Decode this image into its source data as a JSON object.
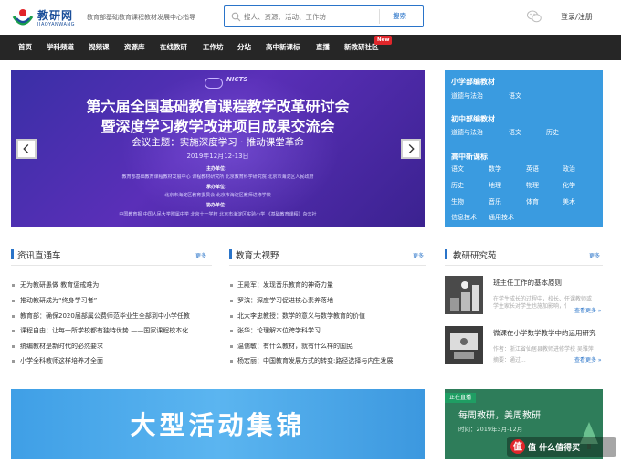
{
  "header": {
    "logo_name": "教研网",
    "logo_en": "JIAOYANWANG",
    "slogan": "教育部基础教育课程教材发展中心指导",
    "search_placeholder": "搜人、资源、活动、工作坊",
    "search_button": "搜索",
    "login": "登录/注册"
  },
  "nav": {
    "items": [
      "首页",
      "学科频道",
      "视频课",
      "资源库",
      "在线教研",
      "工作坊",
      "分站",
      "高中新课标",
      "直播",
      "新教研社区"
    ],
    "badge": "New"
  },
  "banner": {
    "logo_text": "NICTS",
    "title1": "第六届全国基础教育课程教学改革研讨会",
    "title2": "暨深度学习教学改进项目成果交流会",
    "theme": "会议主题：实施深度学习 · 推动课堂革命",
    "date": "2019年12月12-13日",
    "organizer_label": "主办单位：",
    "organizers": "教育部基础教育课程教材发展中心  课程教材研究所  北京教育科学研究院  北京市海淀区人民政府",
    "undertaker_label": "承办单位：",
    "undertakers": "北京市海淀区教育委员会  北京市海淀区教师进修学校",
    "co_label": "协办单位：",
    "co_orgs": "中国教育报  中国人民大学附属中学  北京十一学校  北京市海淀区实验小学  《基础教育课程》杂志社"
  },
  "subjects": {
    "primary_title": "小学部编教材",
    "primary": [
      "道德与法治",
      "语文"
    ],
    "middle_title": "初中部编教材",
    "middle": [
      "道德与法治",
      "语文",
      "历史"
    ],
    "high_title": "高中新课标",
    "high": [
      "语文",
      "数学",
      "英语",
      "政治",
      "历史",
      "地理",
      "物理",
      "化学",
      "生物",
      "音乐",
      "体育",
      "美术",
      "信息技术",
      "通用技术"
    ]
  },
  "news": {
    "title": "资讯直通车",
    "more": "更多",
    "items": [
      "无为教研愚做  教育惩戒难为",
      "推动教研成为“终身学习者”",
      "教育部：确保2020届部属公费师范毕业生全部到中小学任教",
      "课程自由：让每一所学校都有独特优势 ——国家课程校本化",
      "统编教材是新时代的必然要求",
      "小学全科教师这样培养才全面"
    ]
  },
  "vision": {
    "title": "教育大视野",
    "more": "更多",
    "items": [
      "王殿军：发现音乐教育的神奇力量",
      "罗滨：深度学习促进核心素养落地",
      "北大李忠教授：数学的意义与数学教育的价值",
      "张华：论理解本位跨学科学习",
      "温儒敏：有什么教材，就有什么样的国民",
      "杨宏丽：中国教育发展方式的转变:路径选择与内生发展"
    ]
  },
  "research": {
    "title": "教研研究苑",
    "more": "更多",
    "items": [
      {
        "title": "班主任工作的基本原则",
        "desc1": "在学生成长的过程中，校长、任课教师或",
        "desc2": "学生家长对学生也施加影响，但...",
        "more": "查看更多 »"
      },
      {
        "title": "微课在小学数学教学中的运用研究",
        "desc1": "作者：浙江省仙居县教师进修学校  吴雅萍",
        "desc2": "摘要：通过...",
        "more": "查看更多 »"
      }
    ]
  },
  "event": {
    "title": "大型活动集锦"
  },
  "live": {
    "badge": "正在直播",
    "title": "每周教研，美周教研",
    "time": "时间：2019年3月-12月"
  },
  "watermark": "值 什么值得买",
  "colors": {
    "brand": "#2a74c9",
    "nav_bg": "#262626",
    "subject_bg": "#3a9be0",
    "live_bg": "#2e7d5a",
    "badge_red": "#e0262b"
  }
}
